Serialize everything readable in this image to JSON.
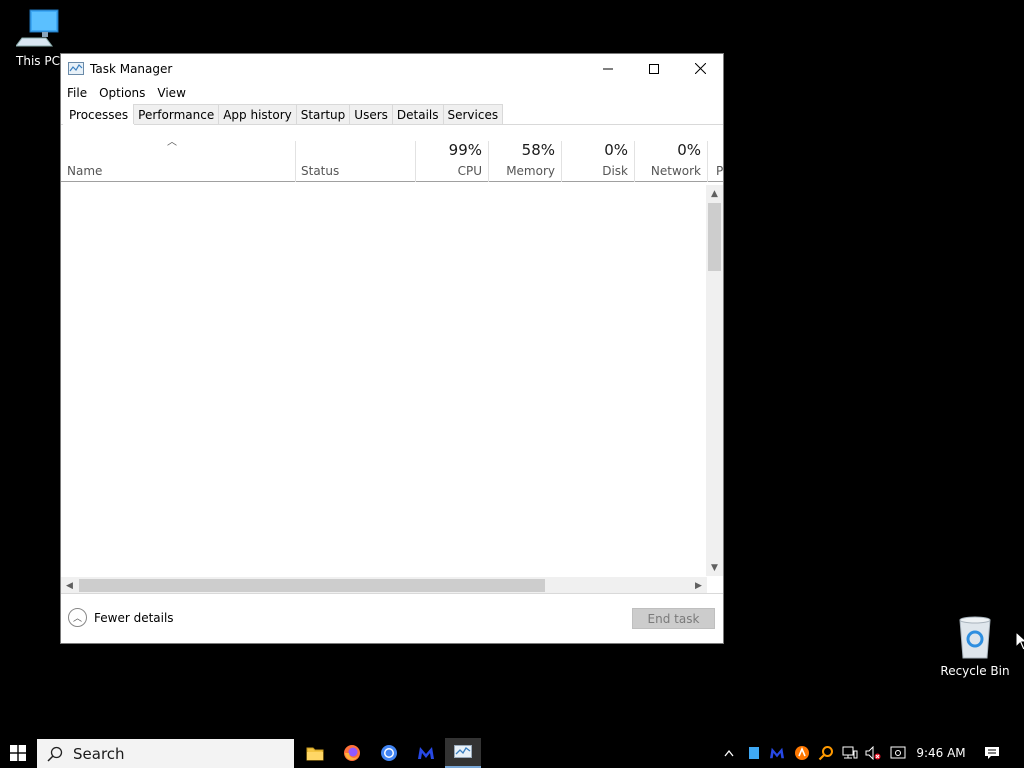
{
  "desktop": {
    "this_pc_label": "This PC",
    "recycle_bin_label": "Recycle Bin"
  },
  "window": {
    "title": "Task Manager",
    "menu": [
      "File",
      "Options",
      "View"
    ],
    "tabs": [
      "Processes",
      "Performance",
      "App history",
      "Startup",
      "Users",
      "Details",
      "Services"
    ],
    "active_tab": "Processes",
    "columns": {
      "name": "Name",
      "status": "Status",
      "cpu": {
        "pct": "99%",
        "label": "CPU"
      },
      "memory": {
        "pct": "58%",
        "label": "Memory"
      },
      "disk": {
        "pct": "0%",
        "label": "Disk"
      },
      "network": {
        "pct": "0%",
        "label": "Network"
      },
      "power_partial": "P"
    },
    "footer": {
      "fewer_details": "Fewer details",
      "end_task": "End task"
    }
  },
  "taskbar": {
    "search_placeholder": "Search",
    "clock": "9:46 AM",
    "apps": [
      "file-explorer-icon",
      "firefox-icon",
      "chrome-icon",
      "malwarebytes-icon",
      "task-manager-icon"
    ]
  },
  "colors": {
    "desktop_bg": "#000000",
    "window_bg": "#ffffff",
    "accent": "#7aa8d8",
    "firefox": "#ff7139",
    "chrome_blue": "#4285f4",
    "malwarebytes": "#2749e6",
    "folder": "#f4c542"
  }
}
